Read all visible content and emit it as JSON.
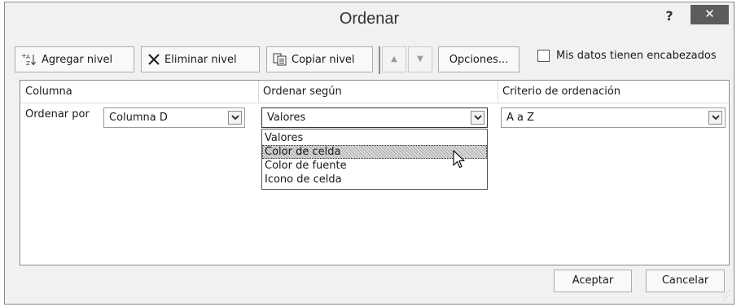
{
  "window": {
    "title": "Ordenar",
    "help_label": "?",
    "close_label": "✕"
  },
  "toolbar": {
    "add_level_label": "Agregar nivel",
    "delete_level_label": "Eliminar nivel",
    "copy_level_label": "Copiar nivel",
    "move_up_label": "▲",
    "move_down_label": "▼",
    "options_label": "Opciones...",
    "headers_checkbox_label": "Mis datos tienen encabezados",
    "headers_checked": false
  },
  "grid": {
    "headers": [
      "Columna",
      "Ordenar según",
      "Criterio de ordenación"
    ],
    "row": {
      "label": "Ordenar por",
      "column_value": "Columna D",
      "sort_on_value": "Valores",
      "order_value": "A a Z"
    }
  },
  "sort_on_dropdown": {
    "options": [
      "Valores",
      "Color de celda",
      "Color de fuente",
      "Icono de celda"
    ],
    "hovered_index": 1
  },
  "footer": {
    "ok_label": "Aceptar",
    "cancel_label": "Cancelar"
  },
  "colors": {
    "dialog_bg": "#f1f1f1",
    "close_button": "#5c5c5c",
    "hover_highlight": "#d8d8d8"
  }
}
